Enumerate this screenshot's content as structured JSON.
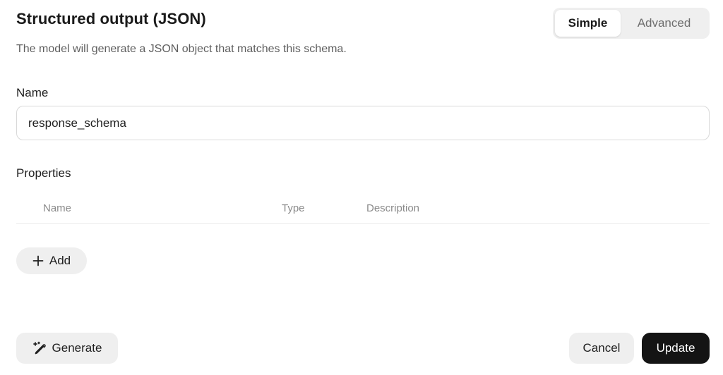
{
  "header": {
    "title": "Structured output (JSON)",
    "subtitle": "The model will generate a JSON object that matches this schema."
  },
  "mode_toggle": {
    "options": [
      "Simple",
      "Advanced"
    ],
    "selected": "Simple"
  },
  "name_field": {
    "label": "Name",
    "value": "response_schema"
  },
  "properties": {
    "label": "Properties",
    "columns": [
      "Name",
      "Type",
      "Description"
    ],
    "rows": [],
    "add_label": "Add"
  },
  "footer": {
    "generate_label": "Generate",
    "cancel_label": "Cancel",
    "update_label": "Update"
  },
  "icons": {
    "add": "plus-icon",
    "generate": "magic-pen-icon"
  },
  "colors": {
    "primary_button": "#141414",
    "secondary_button": "#efefef"
  }
}
